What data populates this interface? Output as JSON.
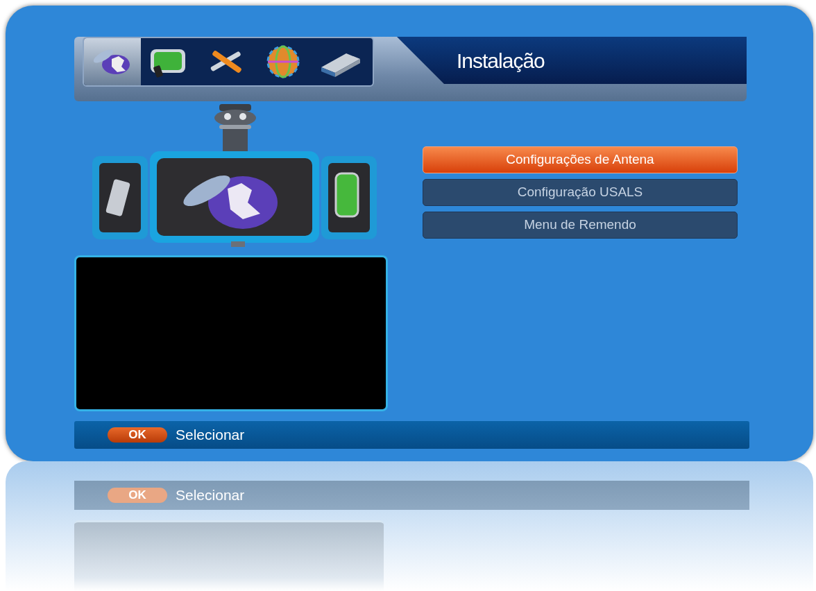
{
  "header": {
    "tabs": [
      {
        "kind": "satellite",
        "selected": true
      },
      {
        "kind": "tv",
        "selected": false
      },
      {
        "kind": "tools",
        "selected": false
      },
      {
        "kind": "globe",
        "selected": false
      },
      {
        "kind": "usb",
        "selected": false
      }
    ],
    "title": "Instalação"
  },
  "menu": [
    {
      "label": "Configurações de Antena",
      "selected": true
    },
    {
      "label": "Configuração USALS",
      "selected": false
    },
    {
      "label": "Menu de Remendo",
      "selected": false
    }
  ],
  "footer": {
    "key": "OK",
    "action": "Selecionar"
  },
  "reflection": {
    "key": "OK",
    "action": "Selecionar"
  }
}
